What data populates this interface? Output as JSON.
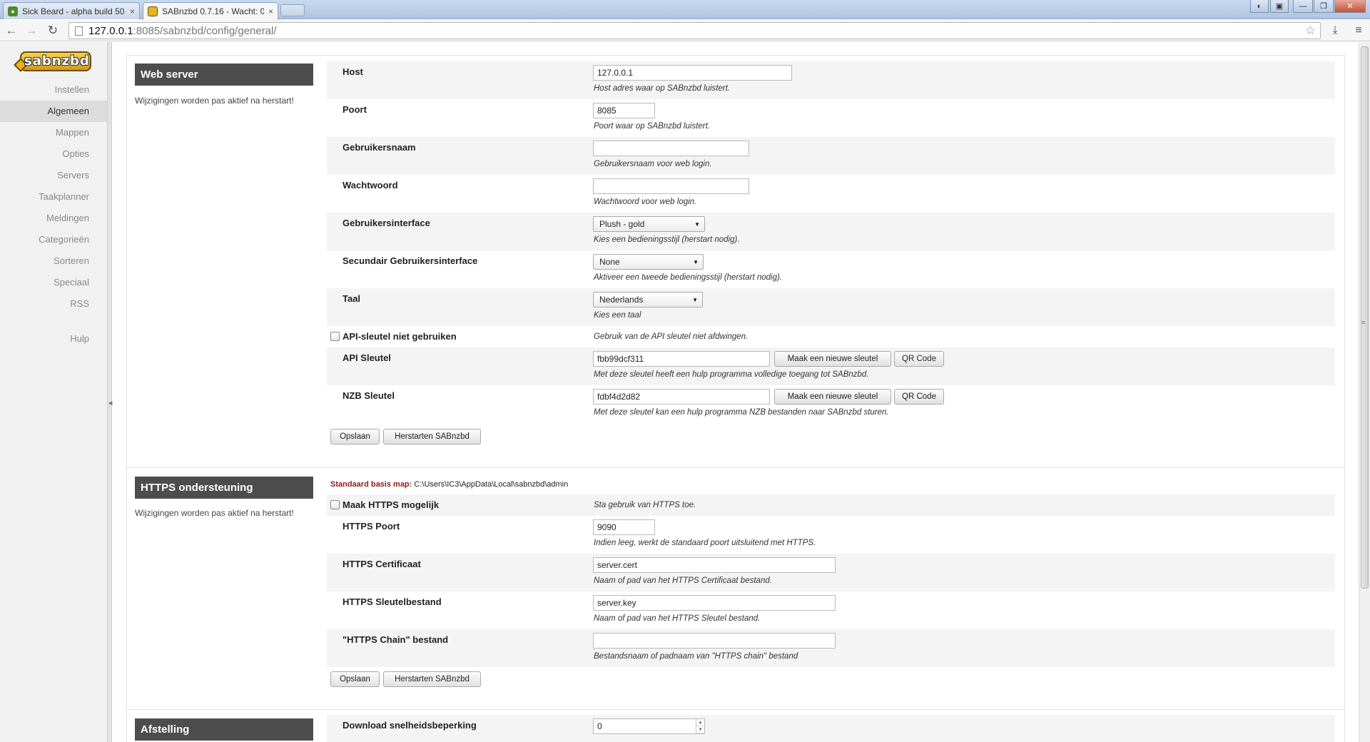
{
  "browser": {
    "tabs": [
      {
        "title": "Sick Beard - alpha build 50",
        "close": "×"
      },
      {
        "title": "SABnzbd 0.7.16 - Wacht: 0",
        "close": "×"
      }
    ],
    "url_host": "127.0.0.1",
    "url_path": ":8085/sabnzbd/config/general/"
  },
  "sidebar": {
    "logo_text": "sabnzbd",
    "items": [
      {
        "label": "Instellen"
      },
      {
        "label": "Algemeen"
      },
      {
        "label": "Mappen"
      },
      {
        "label": "Opties"
      },
      {
        "label": "Servers"
      },
      {
        "label": "Taakplanner"
      },
      {
        "label": "Meldingen"
      },
      {
        "label": "Categorieën"
      },
      {
        "label": "Sorteren"
      },
      {
        "label": "Speciaal"
      },
      {
        "label": "RSS"
      },
      {
        "label": "Hulp"
      }
    ],
    "active_item": "Algemeen"
  },
  "webserver": {
    "title": "Web server",
    "note": "Wijzigingen worden pas aktief na herstart!",
    "host": {
      "label": "Host",
      "value": "127.0.0.1",
      "desc": "Host adres waar op SABnzbd luistert."
    },
    "port": {
      "label": "Poort",
      "value": "8085",
      "desc": "Poort waar op SABnzbd luistert."
    },
    "username": {
      "label": "Gebruikersnaam",
      "value": "",
      "desc": "Gebruikersnaam voor web login."
    },
    "password": {
      "label": "Wachtwoord",
      "value": "",
      "desc": "Wachtwoord voor web login."
    },
    "ui": {
      "label": "Gebruikersinterface",
      "value": "Plush - gold",
      "desc": "Kies een bedieningsstijl (herstart nodig)."
    },
    "ui2": {
      "label": "Secundair Gebruikersinterface",
      "value": "None",
      "desc": "Aktiveer een tweede bedieningsstijl (herstart nodig)."
    },
    "language": {
      "label": "Taal",
      "value": "Nederlands",
      "desc": "Kies een taal"
    },
    "no_api": {
      "label": "API-sleutel niet gebruiken",
      "desc": "Gebruik van de API sleutel niet afdwingen."
    },
    "api_key": {
      "label": "API Sleutel",
      "value": "fbb99dcf311",
      "new_btn": "Maak een nieuwe sleutel",
      "qr_btn": "QR Code",
      "desc": "Met deze sleutel heeft een hulp programma volledige toegang tot SABnzbd."
    },
    "nzb_key": {
      "label": "NZB Sleutel",
      "value": "fdbf4d2d82",
      "new_btn": "Maak een nieuwe sleutel",
      "qr_btn": "QR Code",
      "desc": "Met deze sleutel kan een hulp programma NZB bestanden naar SABnzbd sturen."
    },
    "save_btn": "Opslaan",
    "restart_btn": "Herstarten SABnzbd"
  },
  "https": {
    "title": "HTTPS ondersteuning",
    "note": "Wijzigingen worden pas aktief na herstart!",
    "basemap_label": "Standaard basis map:",
    "basemap_value": "C:\\Users\\IC3\\AppData\\Local\\sabnzbd\\admin",
    "enable": {
      "label": "Maak HTTPS mogelijk",
      "desc": "Sta gebruik van HTTPS toe."
    },
    "port": {
      "label": "HTTPS Poort",
      "value": "9090",
      "desc": "Indien leeg, werkt de standaard poort uitsluitend met HTTPS."
    },
    "cert": {
      "label": "HTTPS Certificaat",
      "value": "server.cert",
      "desc": "Naam of pad van het HTTPS Certificaat bestand."
    },
    "key": {
      "label": "HTTPS Sleutelbestand",
      "value": "server.key",
      "desc": "Naam of pad van het HTTPS Sleutel bestand."
    },
    "chain": {
      "label": "\"HTTPS Chain\" bestand",
      "value": "",
      "desc": "Bestandsnaam of padnaam van \"HTTPS chain\" bestand"
    },
    "save_btn": "Opslaan",
    "restart_btn": "Herstarten SABnzbd"
  },
  "tuning": {
    "title": "Afstelling",
    "speed": {
      "label": "Download snelheidsbeperking",
      "value": "0"
    }
  },
  "colors": {
    "section_header": "#4d4d4d",
    "row_shade": "#f4f4f4",
    "basemap_label": "#8b1a1a"
  }
}
